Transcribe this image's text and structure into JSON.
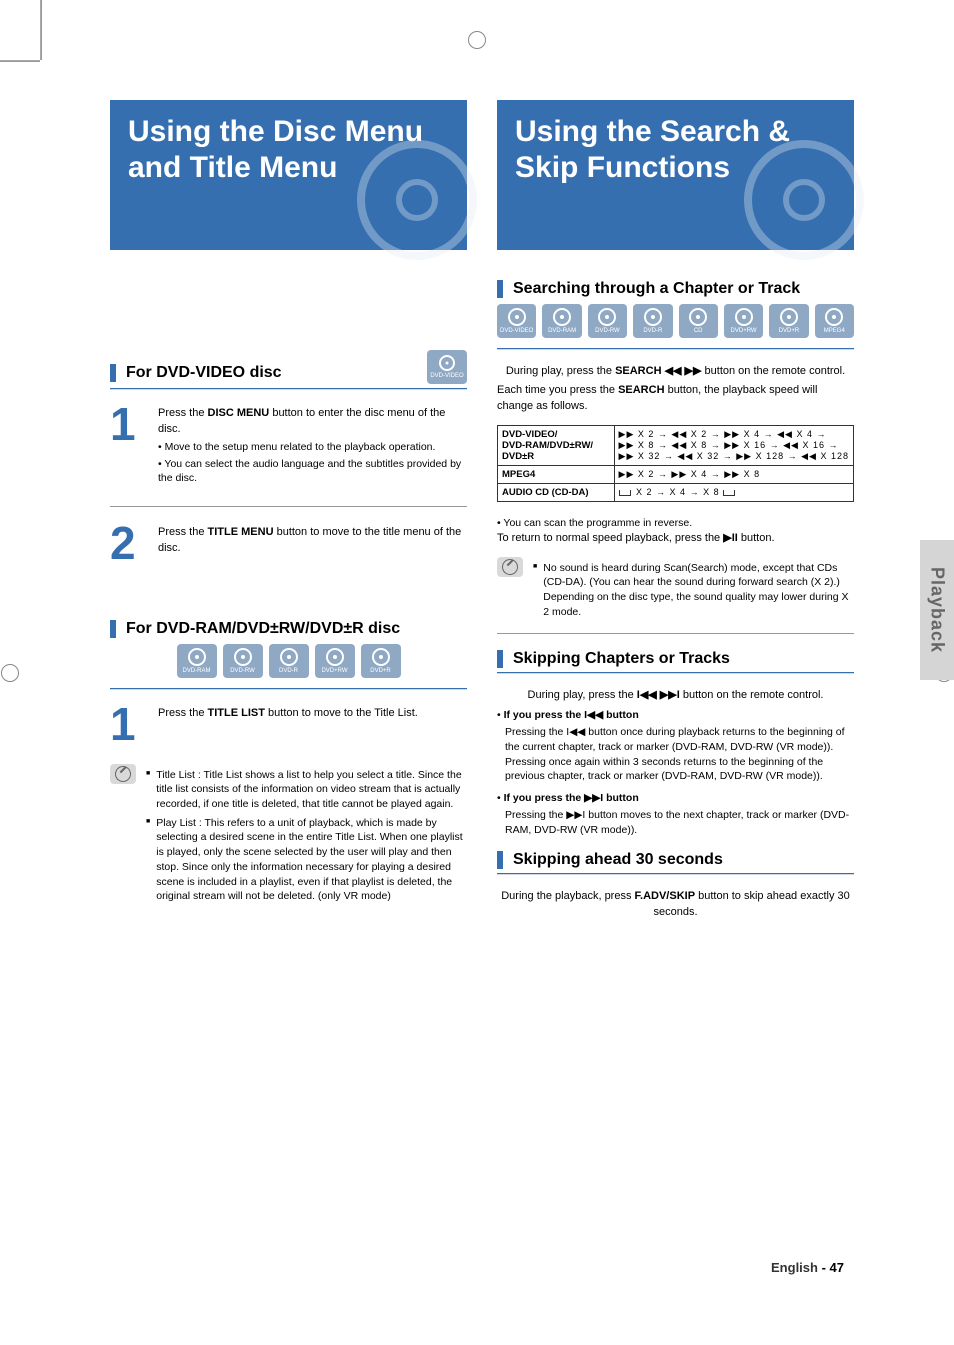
{
  "side_tab": "Playback",
  "page_label": "English",
  "page_number": "- 47",
  "left": {
    "heading": "Using the Disc Menu and Title Menu",
    "section1": {
      "title": "For DVD-VIDEO disc",
      "badge": "DVD-VIDEO",
      "step1": {
        "act": "DISC MENU",
        "line1": "Press the DISC MENU button to enter the disc menu of the disc.",
        "b1": "Move to the setup menu related to the playback operation.",
        "b2": "You can select the audio language and the subtitles provided by the disc."
      },
      "step2": {
        "act": "TITLE MENU",
        "line1": "Press the TITLE MENU button to move to the title menu of the disc."
      }
    },
    "section2": {
      "title": "For DVD-RAM/DVD±RW/DVD±R disc",
      "badges": [
        "DVD-RAM",
        "DVD-RW",
        "DVD-R",
        "DVD+RW",
        "DVD+R"
      ],
      "step1": {
        "act": "TITLE LIST",
        "line1": "Press the TITLE LIST button to move to the Title List."
      },
      "note1": "Title List : Title List shows a list to help you select a title. Since the title list consists of the information on video stream that is actually recorded, if one title is deleted, that title cannot be played again.",
      "note2": "Play List : This refers to a unit of playback, which is made by selecting a desired scene in the entire Title List. When one playlist is played, only the scene selected by the user will play and then stop. Since only the information necessary for playing a desired scene is included in a playlist, even if that playlist is deleted, the original stream will not be deleted. (only VR mode)"
    }
  },
  "right": {
    "heading": "Using the Search & Skip Functions",
    "section1": {
      "title": "Searching through a Chapter or Track",
      "badges": [
        "DVD-VIDEO",
        "DVD-RAM",
        "DVD-RW",
        "DVD-R",
        "CD",
        "DVD+RW",
        "DVD+R",
        "MPEG4"
      ],
      "search_line_pre": "During play, press the ",
      "search_line_mid": "SEARCH ◀◀   ▶▶",
      "search_line_post": " button on the remote control.",
      "press_each": "Each time you press the SEARCH button, the playback speed will change as follows.",
      "table": {
        "rows": [
          {
            "label": "DVD-VIDEO/\nDVD-RAM/DVD±RW/\nDVD±R",
            "val": "▶▶ X 2 → ◀◀ X 2 → ▶▶ X 4 → ◀◀ X 4 →\n▶▶ X 8 → ◀◀ X 8 → ▶▶ X 16 → ◀◀ X 16 →\n▶▶ X 32 → ◀◀ X 32 → ▶▶ X 128 → ◀◀ X 128"
          },
          {
            "label": "MPEG4",
            "val": "▶▶ X 2 → ▶▶ X 4 → ▶▶ X 8"
          },
          {
            "label": "AUDIO CD (CD-DA)",
            "val": "X 2 → X 4 → X 8"
          }
        ]
      },
      "scan_line": "You can scan the programme in reverse.",
      "return_line": "To return to normal speed playback, press the ▶II button.",
      "note": "No sound is heard during Scan(Search) mode, except that CDs (CD-DA). (You can hear the sound during forward search (X 2).) Depending on the disc type, the sound quality may lower during X 2 mode."
    },
    "section2": {
      "title": "Skipping Chapters or Tracks",
      "line1_pre": "During play, press the ",
      "line1_mid": "I◀◀   ▶▶I",
      "line1_post": " button on the remote control.",
      "press_prev_label": "If you press the I◀◀ button",
      "press_prev_body": "Pressing the I◀◀ button once during playback returns to the beginning of the current chapter, track or marker (DVD-RAM, DVD-RW (VR mode)). Pressing once again within 3 seconds returns to the beginning of the previous chapter, track or marker (DVD-RAM, DVD-RW (VR mode)).",
      "press_next_label": "If you press the ▶▶I button",
      "press_next_body": "Pressing the ▶▶I button moves to the next chapter, track or marker (DVD-RAM, DVD-RW (VR mode))."
    },
    "section3": {
      "title": "Skipping ahead 30 seconds",
      "body_pre": "During the playback, press ",
      "body_mid": "F.ADV/SKIP",
      "body_post": " button to skip ahead exactly 30 seconds."
    }
  }
}
